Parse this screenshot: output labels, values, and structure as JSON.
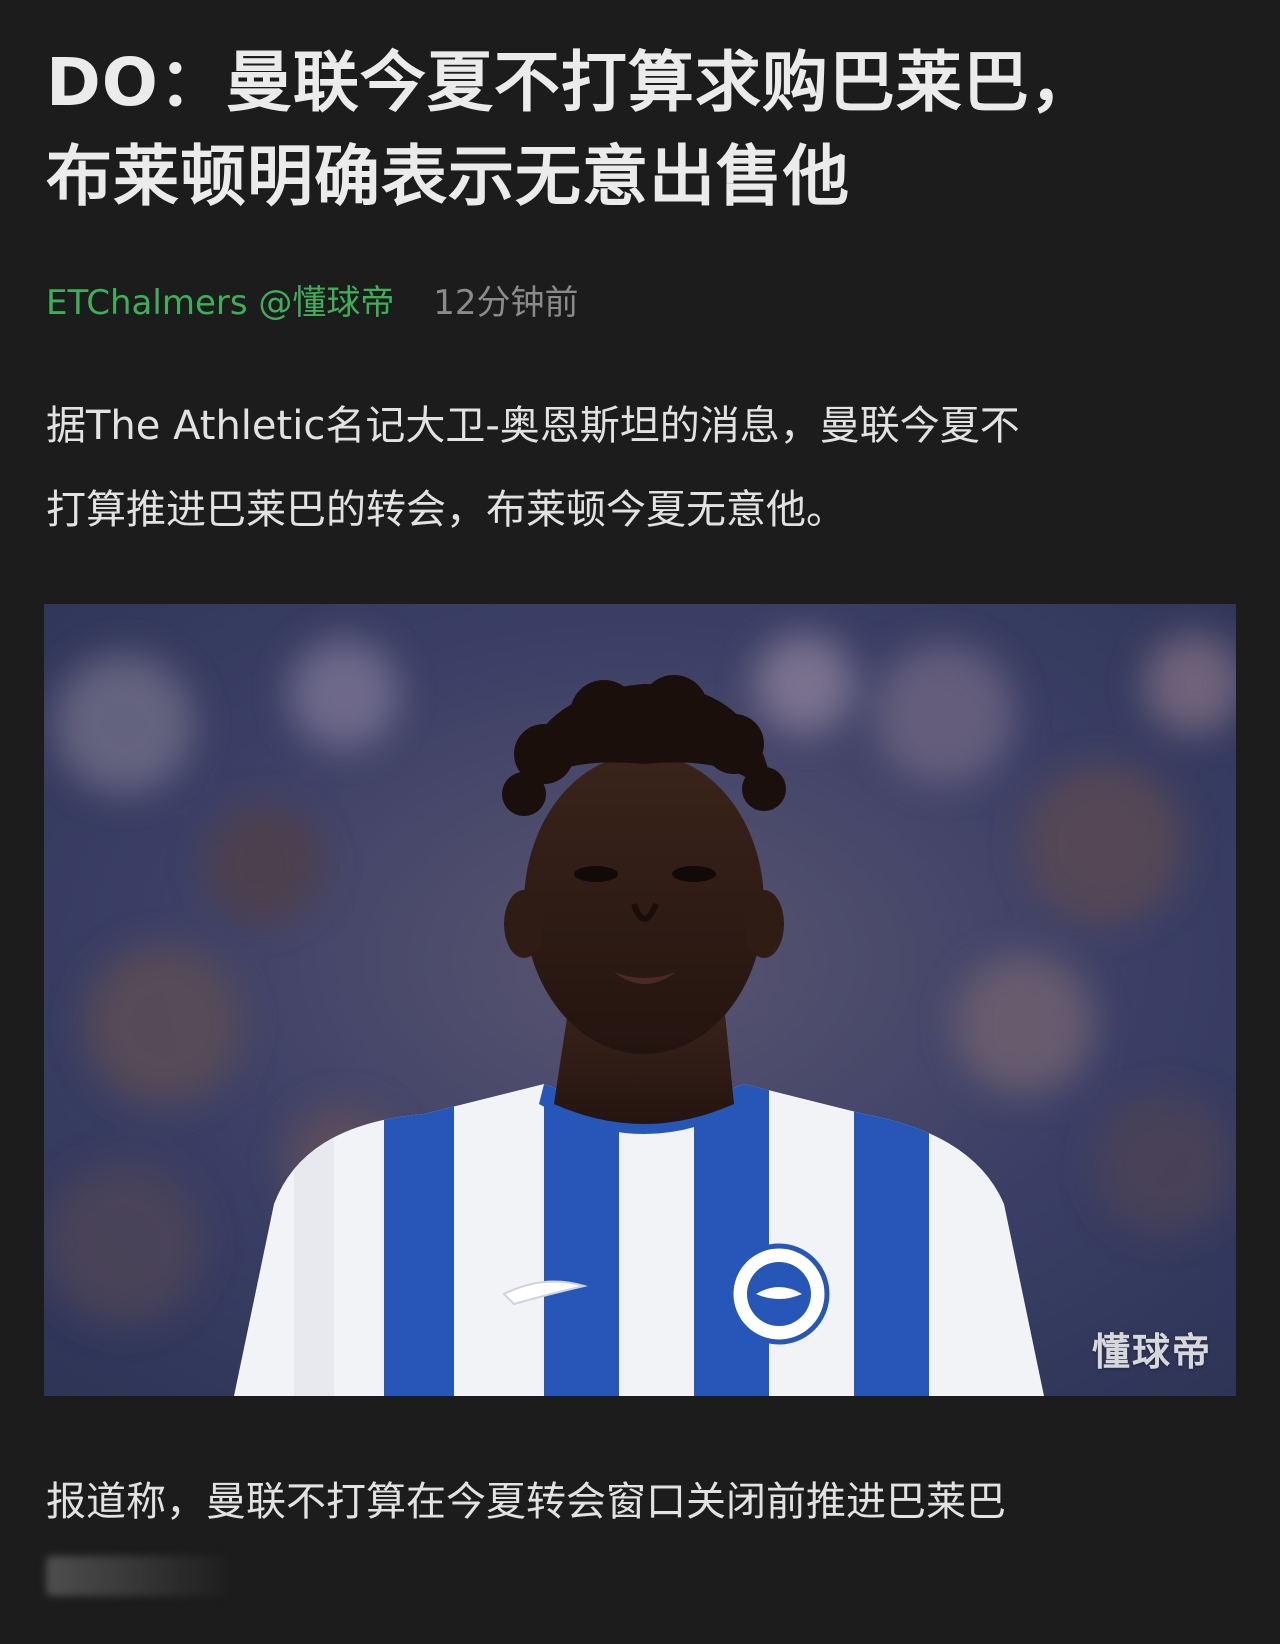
{
  "article": {
    "title_lines": [
      "DO：曼联今夏不打算求购巴莱巴，",
      "布莱顿明确表示无意出售他"
    ],
    "author": "ETChalmers @懂球帝",
    "time": "12分钟前",
    "paragraph1_lines": [
      "据The Athletic名记大卫-奥恩斯坦的消息，曼联今夏不",
      "打算推进巴莱巴的转会，布莱顿今夏无意他。"
    ],
    "image": {
      "watermark": "懂球帝"
    },
    "paragraph2_lines": [
      "报道称，曼联不打算在今夏转会窗口关闭前推进巴莱巴"
    ]
  },
  "colors": {
    "background": "#1c1c1c",
    "author": "#3fae5a",
    "time": "#8a8a8a",
    "text": "#e2e2e2"
  }
}
